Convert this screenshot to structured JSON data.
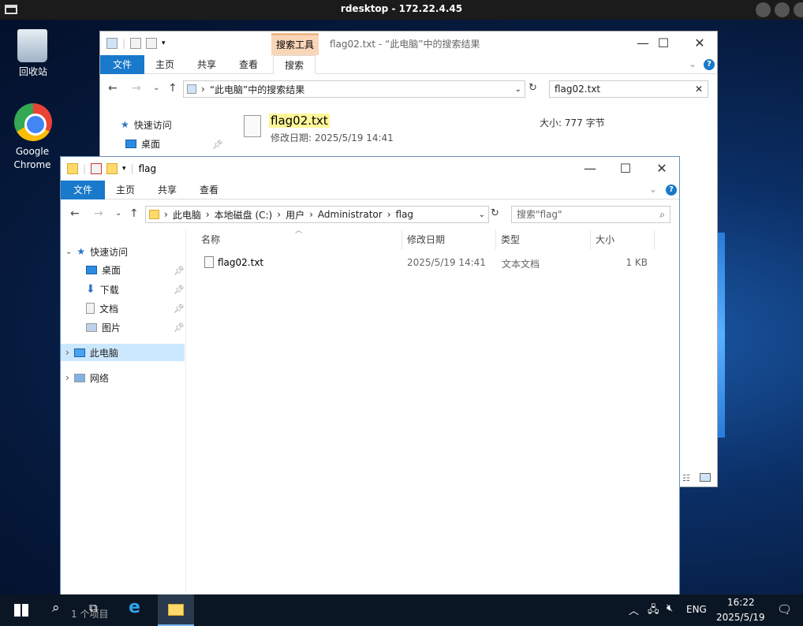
{
  "rdp": {
    "title": "rdesktop - 172.22.4.45"
  },
  "desktop": {
    "recycle_label": "回收站",
    "chrome_label_1": "Google",
    "chrome_label_2": "Chrome"
  },
  "search_window": {
    "title": "flag02.txt - “此电脑”中的搜索结果",
    "context_tab": "搜索工具",
    "tabs": [
      "文件",
      "主页",
      "共享",
      "查看",
      "搜索"
    ],
    "address": "“此电脑”中的搜索结果",
    "search_value": "flag02.txt",
    "sidebar": {
      "quick_access": "快速访问",
      "desktop": "桌面"
    },
    "result": {
      "name": "flag02.txt",
      "modified": "修改日期: 2025/5/19 14:41",
      "size": "大小: 777 字节"
    }
  },
  "flag_window": {
    "title": "flag",
    "tabs": [
      "文件",
      "主页",
      "共享",
      "查看"
    ],
    "address": [
      "此电脑",
      "本地磁盘 (C:)",
      "用户",
      "Administrator",
      "flag"
    ],
    "search_placeholder": "搜索\"flag\"",
    "sidebar": [
      "快速访问",
      "桌面",
      "下载",
      "文档",
      "图片",
      "此电脑",
      "网络"
    ],
    "columns": [
      "名称",
      "修改日期",
      "类型",
      "大小"
    ],
    "files": [
      {
        "name": "flag02.txt",
        "date": "2025/5/19 14:41",
        "type": "文本文档",
        "size": "1 KB"
      }
    ],
    "status": "1 个项目"
  },
  "taskbar": {
    "lang": "ENG",
    "time": "16:22",
    "date": "2025/5/19"
  },
  "colors": {
    "accent": "#1979ca",
    "highlight": "#fff799",
    "selected": "#cce8ff",
    "context_tab": "#f9d6b8"
  }
}
